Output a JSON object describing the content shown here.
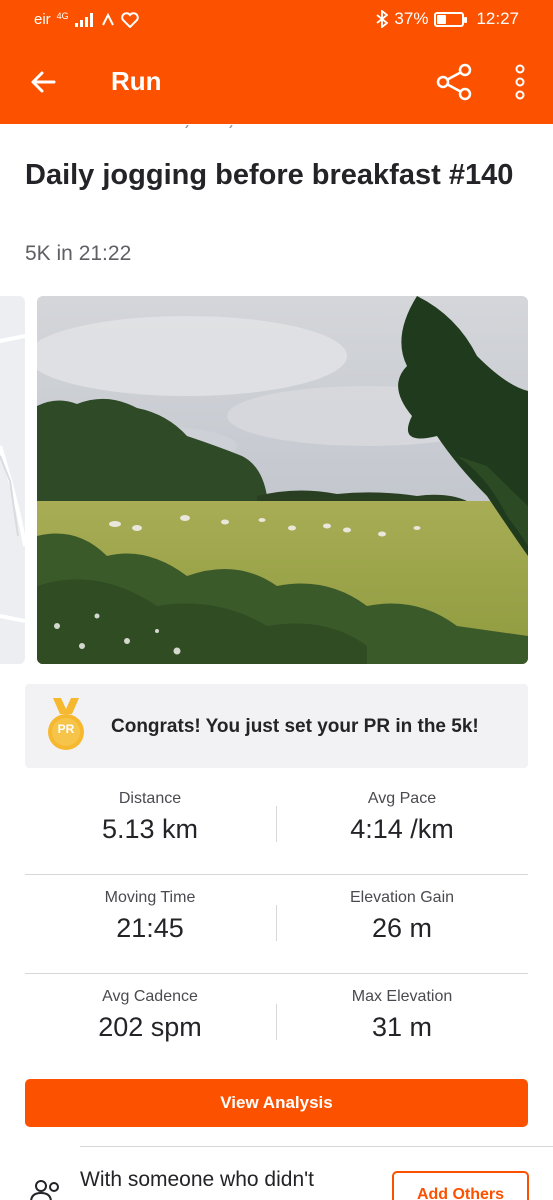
{
  "status_bar": {
    "carrier": "eir",
    "network": "4G",
    "battery_percent": 37,
    "battery_label": "37%",
    "time": "12:27"
  },
  "app_bar": {
    "title": "Run",
    "back_icon": "arrow-left-icon",
    "share_icon": "share-icon",
    "more_icon": "more-vertical-icon"
  },
  "activity": {
    "title": "Daily jogging before breakfast #140",
    "subtitle": "5K in 21:22"
  },
  "pr_banner": {
    "badge": "PR",
    "text": "Congrats! You just set your PR in the 5k!"
  },
  "stats": [
    {
      "left_label": "Distance",
      "left_value": "5.13 km",
      "right_label": "Avg Pace",
      "right_value": "4:14 /km"
    },
    {
      "left_label": "Moving Time",
      "left_value": "21:45",
      "right_label": "Elevation Gain",
      "right_value": "26 m"
    },
    {
      "left_label": "Avg Cadence",
      "left_value": "202 spm",
      "right_label": "Max Elevation",
      "right_value": "31 m"
    }
  ],
  "actions": {
    "view_analysis": "View Analysis",
    "with_text": "With someone who didn't",
    "add_others": "Add Others"
  },
  "colors": {
    "brand": "#fc5200",
    "text": "#242428",
    "muted": "#5f5f64",
    "banner_bg": "#f2f2f4",
    "medal": "#f5b82e"
  }
}
